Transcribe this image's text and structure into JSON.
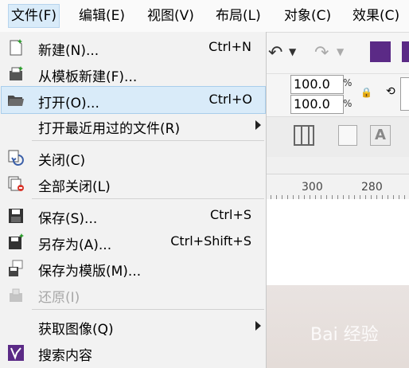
{
  "menubar": [
    {
      "name": "menu-file",
      "label": "文件(F)",
      "active": true
    },
    {
      "name": "menu-edit",
      "label": "编辑(E)"
    },
    {
      "name": "menu-view",
      "label": "视图(V)"
    },
    {
      "name": "menu-layout",
      "label": "布局(L)"
    },
    {
      "name": "menu-object",
      "label": "对象(C)"
    },
    {
      "name": "menu-effects",
      "label": "效果(C)"
    }
  ],
  "file_menu": {
    "new": {
      "label": "新建(N)...",
      "shortcut": "Ctrl+N"
    },
    "new_from_template": {
      "label": "从模板新建(F)..."
    },
    "open": {
      "label": "打开(O)...",
      "shortcut": "Ctrl+O"
    },
    "open_recent": {
      "label": "打开最近用过的文件(R)"
    },
    "close": {
      "label": "关闭(C)"
    },
    "close_all": {
      "label": "全部关闭(L)"
    },
    "save": {
      "label": "保存(S)...",
      "shortcut": "Ctrl+S"
    },
    "save_as": {
      "label": "另存为(A)...",
      "shortcut": "Ctrl+Shift+S"
    },
    "save_as_template": {
      "label": "保存为模版(M)..."
    },
    "revert": {
      "label": "还原(I)",
      "disabled": true
    },
    "acquire_image": {
      "label": "获取图像(Q)"
    },
    "search_content": {
      "label": "搜索内容"
    }
  },
  "toolbar": {
    "scale_x": "100.0",
    "scale_y": "100.0",
    "percent": "%"
  },
  "ruler": {
    "ticks": [
      "300",
      "280"
    ]
  },
  "watermark": "Bai 经验",
  "colors": {
    "highlight": "#d9ebf9",
    "menu_bg": "#f2f2f2",
    "accent_purple": "#5b2a86"
  }
}
